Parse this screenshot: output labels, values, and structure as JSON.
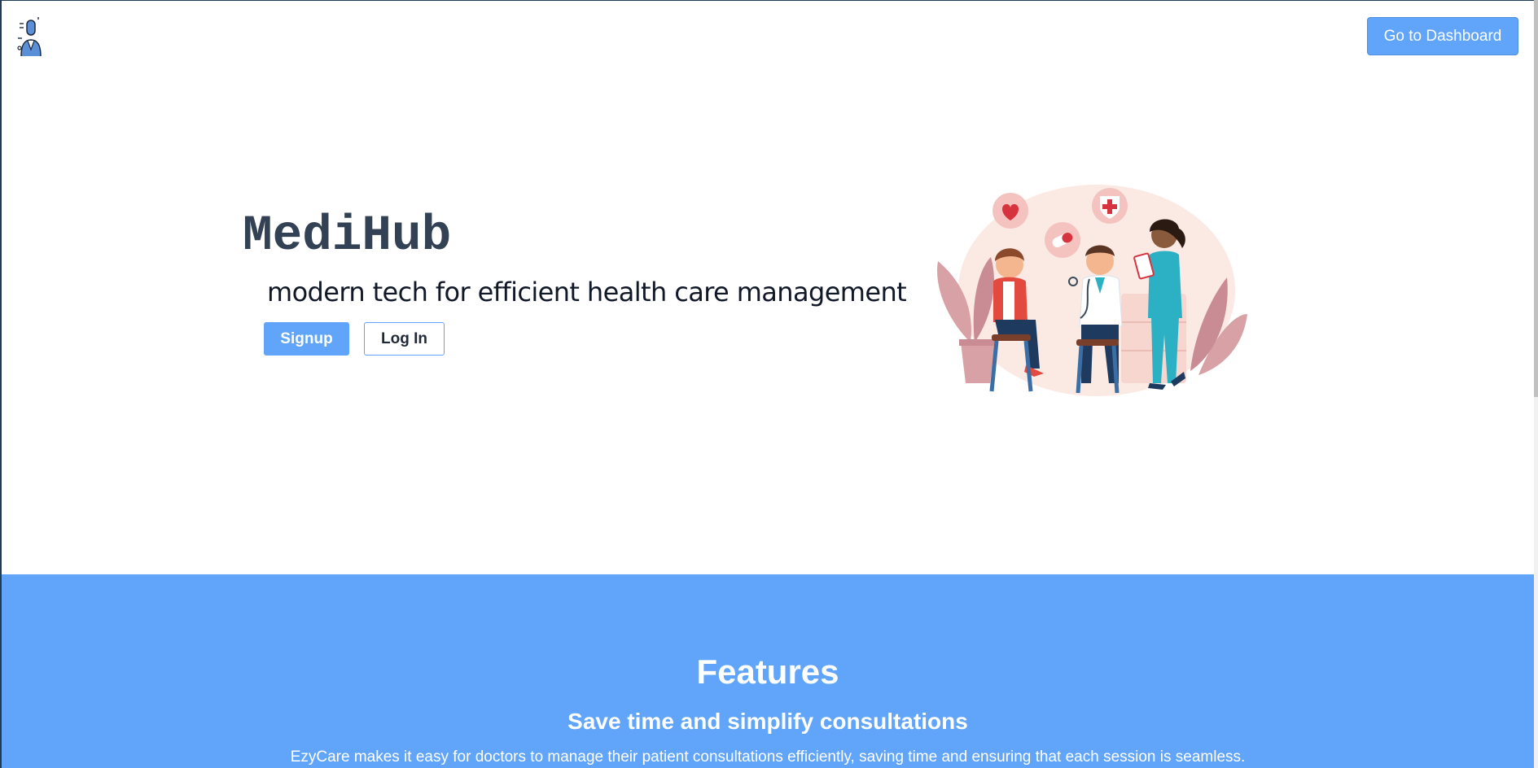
{
  "header": {
    "logo_icon": "doctor-logo-icon",
    "dashboard_button_label": "Go to Dashboard"
  },
  "hero": {
    "title": "MediHub",
    "subtitle": "modern tech for efficient health care management",
    "signup_label": "Signup",
    "login_label": "Log In",
    "illustration": "doctor-patient-consultation-illustration"
  },
  "features": {
    "title": "Features",
    "subtitle": "Save time and simplify consultations",
    "description": "EzyCare makes it easy for doctors to manage their patient consultations efficiently, saving time and ensuring that each session is seamless."
  },
  "colors": {
    "accent": "#60a5fa",
    "title_text": "#334155",
    "frame": "#1f3b57"
  }
}
